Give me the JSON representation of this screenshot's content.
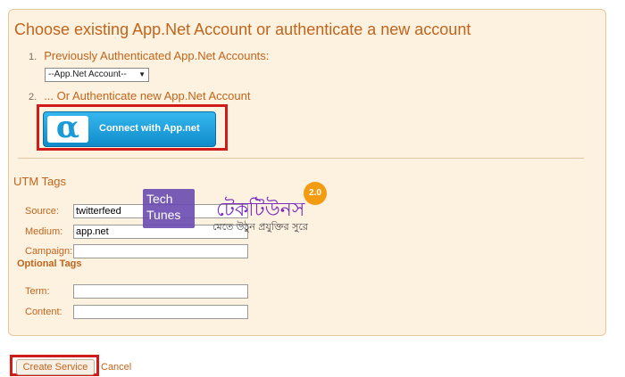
{
  "panel": {
    "title": "Choose existing App.Net Account or authenticate a new account",
    "step1": {
      "num": "1.",
      "label": "Previously Authenticated App.Net Accounts:"
    },
    "account_select": {
      "value": "--App.Net Account--"
    },
    "step2": {
      "num": "2.",
      "label": "... Or Authenticate new App.Net Account"
    },
    "connect_button": {
      "logo": "α",
      "label": "Connect with App.net"
    }
  },
  "utm": {
    "heading": "UTM Tags",
    "fields": [
      {
        "label": "Source:",
        "value": "twitterfeed"
      },
      {
        "label": "Medium:",
        "value": "app.net"
      },
      {
        "label": "Campaign:",
        "value": ""
      }
    ],
    "optional_heading": "Optional Tags",
    "optional_fields": [
      {
        "label": "Term:",
        "value": ""
      },
      {
        "label": "Content:",
        "value": ""
      }
    ]
  },
  "actions": {
    "create": "Create Service",
    "cancel": "Cancel"
  },
  "watermark": {
    "box_text": "Tech Tunes",
    "bengali": "টেকটিউনস",
    "badge": "2.0",
    "tagline": "মেতে উঠুন প্রযুক্তির সুরে"
  },
  "colors": {
    "accent": "#c0651b",
    "panel_bg": "#fdf1e0",
    "highlight": "#d11a1a",
    "button_blue": "#1a9ad9"
  }
}
